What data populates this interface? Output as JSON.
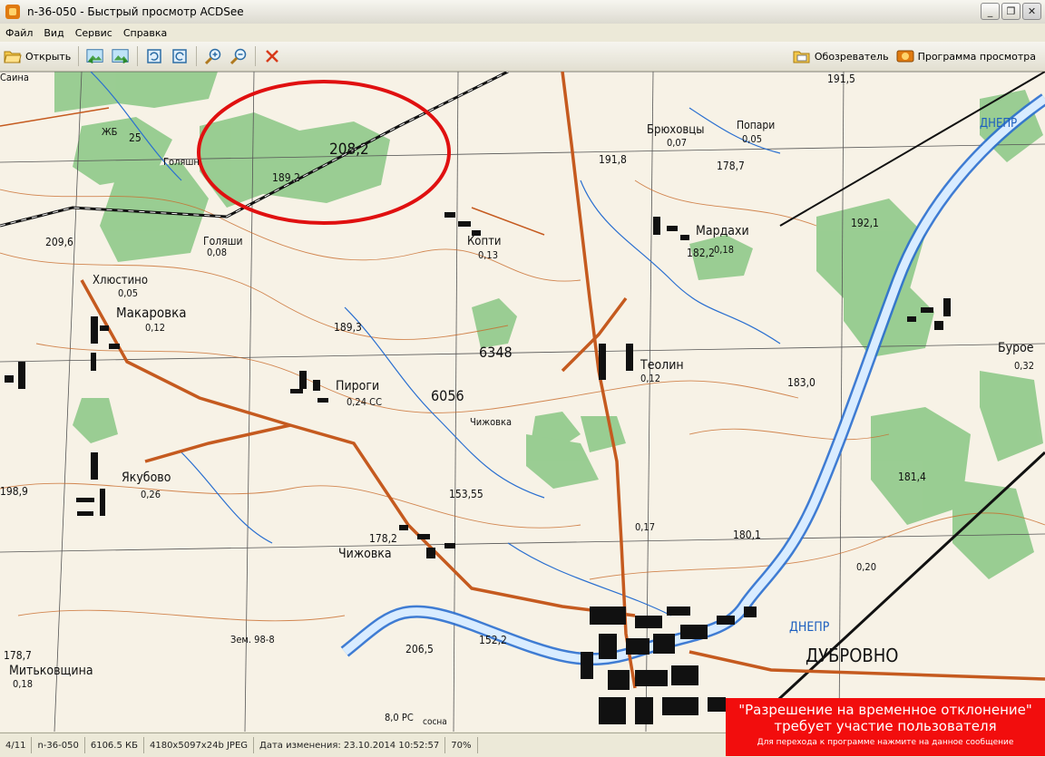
{
  "window": {
    "title": "n-36-050 - Быстрый просмотр ACDSee",
    "minimize": "_",
    "restore": "❐",
    "close": "✕"
  },
  "menu": [
    "Файл",
    "Вид",
    "Сервис",
    "Справка"
  ],
  "toolbar": {
    "open_label": "Открыть",
    "browser_label": "Обозреватель",
    "viewer_label": "Программа просмотра"
  },
  "map": {
    "height_label": "208,2",
    "labels": [
      {
        "t": "Брюховцы",
        "s": 13
      },
      {
        "t": "0,07",
        "s": 11
      },
      {
        "t": "Попари",
        "s": 12
      },
      {
        "t": "0,05",
        "s": 11
      },
      {
        "t": "191,5",
        "s": 12
      },
      {
        "t": "ДНЕПР",
        "s": 13
      },
      {
        "t": "191,8",
        "s": 12
      },
      {
        "t": "178,7",
        "s": 12
      },
      {
        "t": "Голяшн",
        "s": 11
      },
      {
        "t": "189,2",
        "s": 12
      },
      {
        "t": "ЖБ",
        "s": 11
      },
      {
        "t": "25",
        "s": 12
      },
      {
        "t": "Копти",
        "s": 13
      },
      {
        "t": "0,13",
        "s": 11
      },
      {
        "t": "Мардахи",
        "s": 14
      },
      {
        "t": "0,18",
        "s": 11
      },
      {
        "t": "182,2",
        "s": 12
      },
      {
        "t": "192,1",
        "s": 12
      },
      {
        "t": "Голяши",
        "s": 12
      },
      {
        "t": "0,08",
        "s": 11
      },
      {
        "t": "209,6",
        "s": 12
      },
      {
        "t": "Хлюстино",
        "s": 13
      },
      {
        "t": "0,05",
        "s": 11
      },
      {
        "t": "Макаровка",
        "s": 15
      },
      {
        "t": "0,12",
        "s": 11
      },
      {
        "t": "189,3",
        "s": 12
      },
      {
        "t": "6348",
        "s": 16
      },
      {
        "t": "Теолин",
        "s": 14
      },
      {
        "t": "0,12",
        "s": 11
      },
      {
        "t": "Бурое",
        "s": 14
      },
      {
        "t": "0,32",
        "s": 11
      },
      {
        "t": "183,0",
        "s": 12
      },
      {
        "t": "Пироги",
        "s": 14
      },
      {
        "t": "0,24 СС",
        "s": 11
      },
      {
        "t": "6056",
        "s": 16
      },
      {
        "t": "Якубово",
        "s": 14
      },
      {
        "t": "0,26",
        "s": 11
      },
      {
        "t": "Чижовка",
        "s": 11
      },
      {
        "t": "181,4",
        "s": 12
      },
      {
        "t": "198,9",
        "s": 12
      },
      {
        "t": "178,2",
        "s": 12
      },
      {
        "t": "Чижовка",
        "s": 14
      },
      {
        "t": "0,17",
        "s": 11
      },
      {
        "t": "180,1",
        "s": 12
      },
      {
        "t": "153,55",
        "s": 12
      },
      {
        "t": "Зем. 98-8",
        "s": 11
      },
      {
        "t": "178,7",
        "s": 12
      },
      {
        "t": "Митьковщина",
        "s": 14
      },
      {
        "t": "0,18",
        "s": 11
      },
      {
        "t": "206,5",
        "s": 12
      },
      {
        "t": "152,2",
        "s": 12
      },
      {
        "t": "ДНЕПР",
        "s": 14
      },
      {
        "t": "ДУБРОВНО",
        "s": 20
      },
      {
        "t": "8,0 РС",
        "s": 11
      },
      {
        "t": "сосна",
        "s": 10
      },
      {
        "t": "0,20",
        "s": 11
      },
      {
        "t": "Саина",
        "s": 11
      }
    ]
  },
  "alert": {
    "line1": "\"Разрешение на временное отклонение\"",
    "line2": "требует участие пользователя",
    "line3": "Для перехода к программе нажмите на данное сообщение"
  },
  "status": {
    "index": "4/11",
    "filename": "n-36-050",
    "size": "6106.5 КБ",
    "dims": "4180x5097x24b JPEG",
    "date": "Дата изменения: 23.10.2014 10:52:57",
    "zoom": "70%"
  }
}
